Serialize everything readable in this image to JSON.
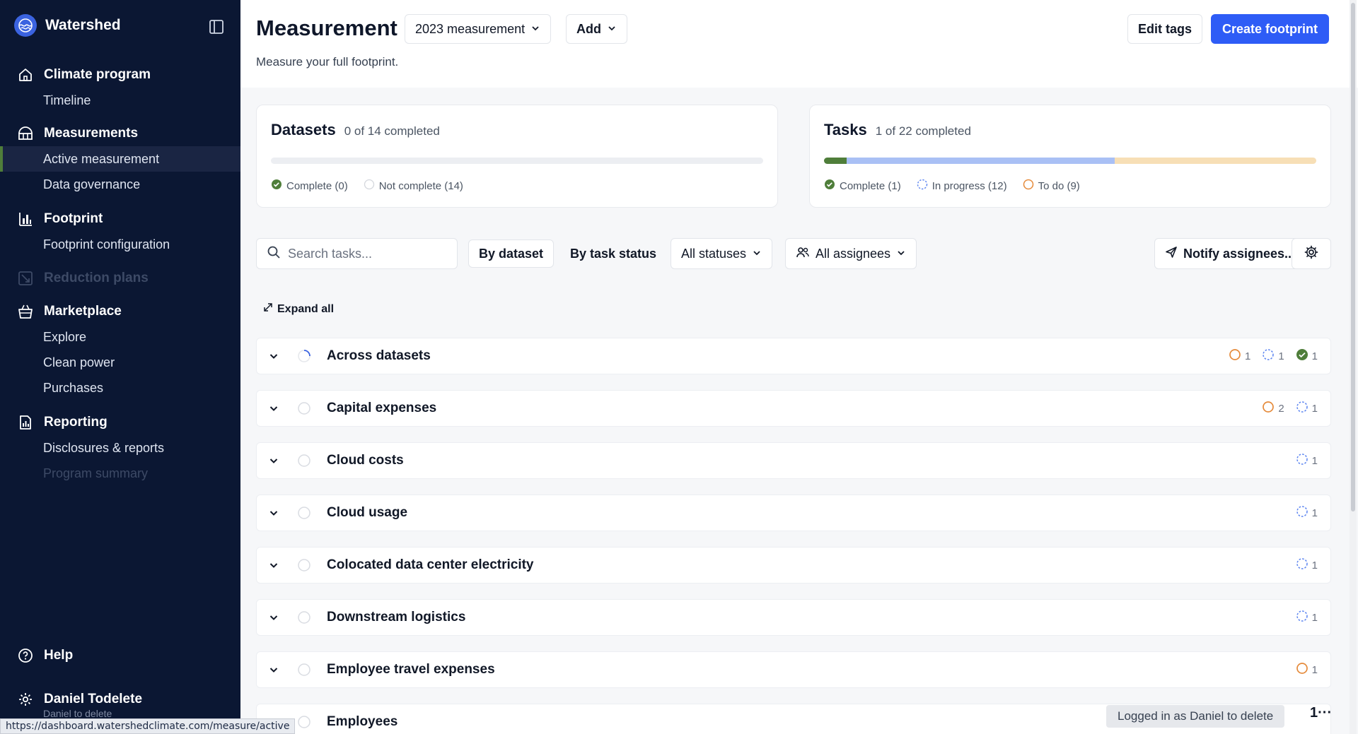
{
  "sidebar": {
    "brand": "Watershed",
    "sections": [
      {
        "label": "Climate program",
        "icon": "home-icon",
        "items": [
          "Timeline"
        ]
      },
      {
        "label": "Measurements",
        "icon": "measurements-icon",
        "items": [
          "Active measurement",
          "Data governance"
        ]
      },
      {
        "label": "Footprint",
        "icon": "bar-chart-icon",
        "items": [
          "Footprint configuration"
        ]
      },
      {
        "label": "Reduction plans",
        "icon": "reduction-icon",
        "items": []
      },
      {
        "label": "Marketplace",
        "icon": "basket-icon",
        "items": [
          "Explore",
          "Clean power",
          "Purchases"
        ]
      },
      {
        "label": "Reporting",
        "icon": "report-icon",
        "items": [
          "Disclosures & reports",
          "Program summary"
        ]
      }
    ],
    "help": "Help",
    "user_name": "Daniel Todelete",
    "user_sub": "Daniel to delete"
  },
  "status_url": "https://dashboard.watershedclimate.com/measure/active",
  "header": {
    "title": "Measurement",
    "measurement_select": "2023 measurement",
    "add_label": "Add",
    "subtitle": "Measure your full footprint.",
    "edit_tags": "Edit tags",
    "create_footprint": "Create footprint"
  },
  "datasets_card": {
    "title": "Datasets",
    "summary": "0 of 14 completed",
    "complete": 0,
    "total": 14,
    "legend": {
      "complete": "Complete (0)",
      "not_complete": "Not complete (14)"
    }
  },
  "tasks_card": {
    "title": "Tasks",
    "summary": "1 of 22 completed",
    "complete": 1,
    "in_progress": 12,
    "to_do": 9,
    "total": 22,
    "legend": {
      "complete": "Complete (1)",
      "in_progress": "In progress (12)",
      "to_do": "To do (9)"
    }
  },
  "toolbar": {
    "search_placeholder": "Search tasks...",
    "by_dataset": "By dataset",
    "by_task_status": "By task status",
    "statuses": "All statuses",
    "assignees": "All assignees",
    "notify": "Notify assignees...",
    "expand_all": "Expand all"
  },
  "rows": [
    {
      "name": "Across datasets",
      "counts": [
        {
          "type": "todo",
          "n": "1"
        },
        {
          "type": "progress",
          "n": "1"
        },
        {
          "type": "done",
          "n": "1"
        }
      ]
    },
    {
      "name": "Capital expenses",
      "counts": [
        {
          "type": "todo",
          "n": "2"
        },
        {
          "type": "progress",
          "n": "1"
        }
      ]
    },
    {
      "name": "Cloud costs",
      "counts": [
        {
          "type": "progress",
          "n": "1"
        }
      ]
    },
    {
      "name": "Cloud usage",
      "counts": [
        {
          "type": "progress",
          "n": "1"
        }
      ]
    },
    {
      "name": "Colocated data center electricity",
      "counts": [
        {
          "type": "progress",
          "n": "1"
        }
      ]
    },
    {
      "name": "Downstream logistics",
      "counts": [
        {
          "type": "progress",
          "n": "1"
        }
      ]
    },
    {
      "name": "Employee travel expenses",
      "counts": [
        {
          "type": "todo",
          "n": "1"
        }
      ]
    },
    {
      "name": "Employees",
      "counts": []
    }
  ],
  "colors": {
    "accent": "#2e5cf6",
    "complete": "#4f7e3a",
    "in_progress": "#a9c0f5",
    "to_do": "#f7dfb6",
    "todo_icon": "#e58a3a",
    "progress_icon": "#5b84f0"
  },
  "logged_in": "Logged in as Daniel to delete",
  "more": "1···"
}
